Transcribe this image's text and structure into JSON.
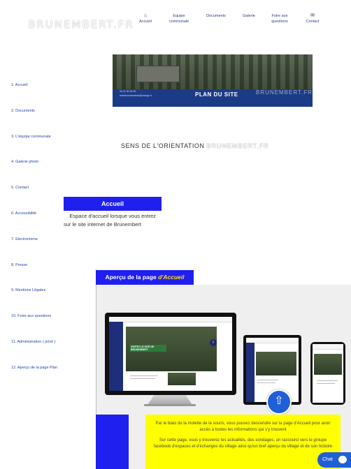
{
  "header": {
    "logo": "BRUNEMBERT.FR",
    "nav": [
      {
        "icon": "home-icon",
        "glyph": "⌂",
        "label": [
          "Accueil"
        ]
      },
      {
        "icon": "",
        "glyph": "",
        "label": [
          "Equipe",
          "communale"
        ]
      },
      {
        "icon": "",
        "glyph": "",
        "label": [
          "Documents"
        ]
      },
      {
        "icon": "",
        "glyph": "",
        "label": [
          "Galerie"
        ]
      },
      {
        "icon": "",
        "glyph": "",
        "label": [
          "Foire aux",
          "questions"
        ]
      },
      {
        "icon": "envelope-icon",
        "glyph": "✉",
        "label": [
          "Contact"
        ]
      }
    ]
  },
  "banner": {
    "title": "PLAN DU SITE",
    "logo": "BRUNEMBERT.FR",
    "phone": "03 21 90 00 00",
    "email": "mairie.brunembert@orange.fr"
  },
  "sidebar": [
    "1. Accueil",
    "2. Documents",
    "3. L'équipe communale",
    "4. Galerie photo",
    "5. Contact",
    "6. Accessibilité",
    "7. Electronisme",
    "8. Presse",
    "9. Mentions Légales",
    "10. Foire aux questions",
    "11. Administration ( privé )",
    "12. Aperçu de la page Plan"
  ],
  "center": {
    "sens": "SENS DE L'ORIENTATION",
    "logo": "BRUNEMBERT.FR"
  },
  "accueil": {
    "heading": "Accueil",
    "text": "Espace d'accueil lorsque vous entrez sur le site internet de Brunembert"
  },
  "preview": {
    "heading_prefix": "Aperçu de la page ",
    "heading_em": "d'Accueil",
    "screen_text": "VISITEZ LE SITE DE BRUNEMBERT"
  },
  "info": {
    "p1": "Par le biais de la molette de la souris, vous pouvez descendre sur la page d'Accueil pour avoir accès à toutes les informations qui s'y trouvent",
    "p2": "Sur cette page, vous y trouverez les actualités, des sondages, un raccourci vers le groupe facebook d'espaces et d'échanges du village ainsi qu'un bref aperçu du village et de son histoire"
  },
  "chat": {
    "label": "Chat"
  },
  "colors": {
    "accent_blue": "#1f1ff0",
    "yellow": "#ffff00",
    "link_blue": "#2646a8"
  }
}
